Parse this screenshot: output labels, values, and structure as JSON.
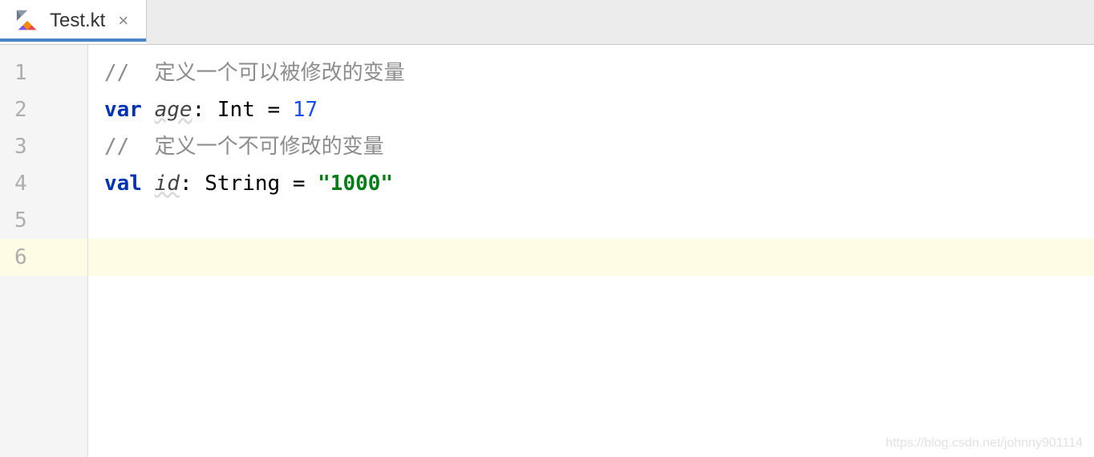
{
  "tab": {
    "filename": "Test.kt",
    "close_glyph": "×"
  },
  "gutter": {
    "lines": [
      "1",
      "2",
      "3",
      "4",
      "5",
      "6"
    ]
  },
  "code": {
    "line1": {
      "comment": "//  定义一个可以被修改的变量"
    },
    "line2": {
      "kw": "var",
      "ident": "age",
      "colon": ":",
      "type": "Int",
      "eq": "=",
      "num": "17"
    },
    "line3": {
      "comment": "//  定义一个不可修改的变量"
    },
    "line4": {
      "kw": "val",
      "ident": "id",
      "colon": ":",
      "type": "String",
      "eq": "=",
      "str": "\"1000\""
    }
  },
  "watermark": "https://blog.csdn.net/johnny901114"
}
